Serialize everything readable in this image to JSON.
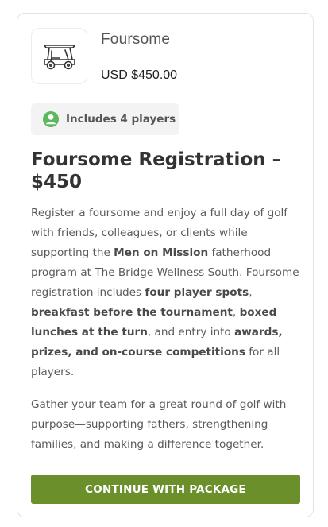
{
  "package": {
    "icon": "golf-cart-icon",
    "name": "Foursome",
    "price": "USD $450.00"
  },
  "badge": {
    "icon": "user-circle-icon",
    "label": "Includes 4 players",
    "icon_color": "#5cb85c"
  },
  "title": "Foursome Registration – $450",
  "description": {
    "p1": [
      {
        "text": "Register a foursome and enjoy a full day of golf with friends, colleagues, or clients while supporting the ",
        "bold": false
      },
      {
        "text": "Men on Mission",
        "bold": true
      },
      {
        "text": " fatherhood program at The Bridge Wellness South. Foursome registration includes ",
        "bold": false
      },
      {
        "text": "four player spots",
        "bold": true
      },
      {
        "text": ", ",
        "bold": false
      },
      {
        "text": "breakfast before the tournament",
        "bold": true
      },
      {
        "text": ", ",
        "bold": false
      },
      {
        "text": "boxed lunches at the turn",
        "bold": true
      },
      {
        "text": ", and entry into ",
        "bold": false
      },
      {
        "text": "awards, prizes, and on-course competitions",
        "bold": true
      },
      {
        "text": " for all players.",
        "bold": false
      }
    ],
    "p2": "Gather your team for a great round of golf with purpose—supporting fathers, strengthening families, and making a difference together."
  },
  "button": {
    "label": "CONTINUE WITH PACKAGE",
    "color": "#6a8f2b"
  }
}
